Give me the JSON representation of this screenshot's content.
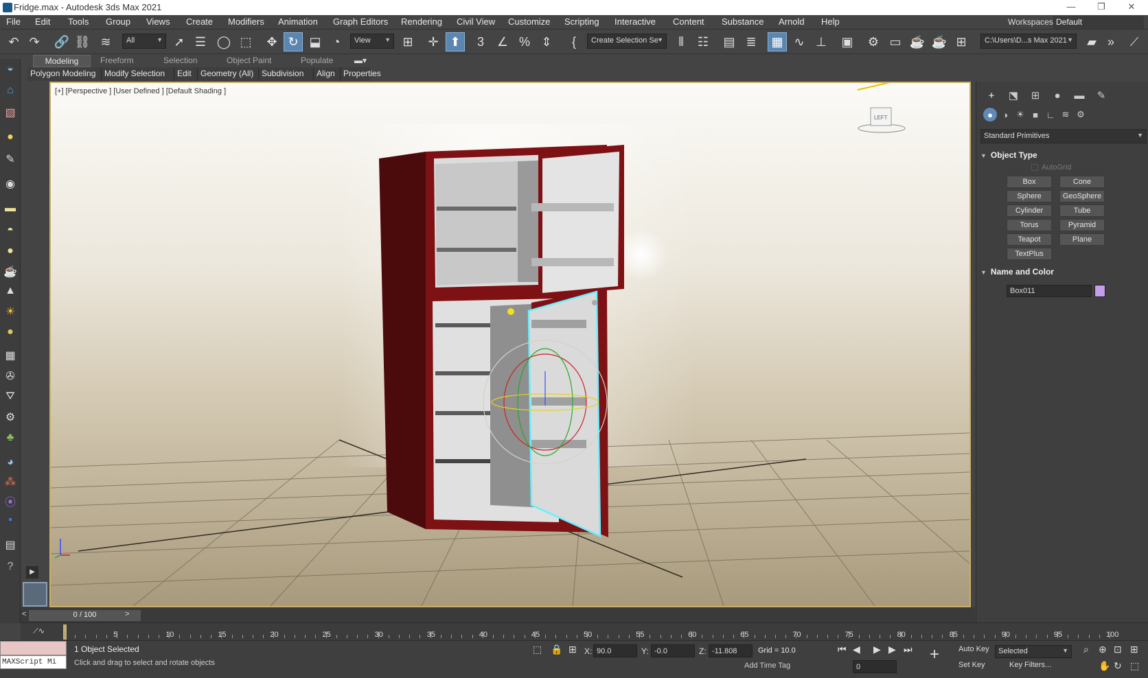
{
  "titlebar": {
    "title": "Fridge.max - Autodesk 3ds Max 2021",
    "minimize": "—",
    "restore": "❐",
    "close": "✕"
  },
  "menu": {
    "items": [
      "File",
      "Edit",
      "Tools",
      "Group",
      "Views",
      "Create",
      "Modifiers",
      "Animation",
      "Graph Editors",
      "Rendering",
      "Civil View",
      "Customize",
      "Scripting",
      "Interactive",
      "Content",
      "Substance",
      "Arnold",
      "Help"
    ],
    "workspaces_label": "Workspaces:",
    "workspace_value": "Default"
  },
  "toolbar": {
    "filter_value": "All",
    "refcoord_value": "View",
    "named_sel_value": "Create Selection Se",
    "path_value": "C:\\Users\\D...s Max 2021"
  },
  "ribbon": {
    "tabs": [
      "Modeling",
      "Freeform",
      "Selection",
      "Object Paint",
      "Populate"
    ],
    "items": [
      "Polygon Modeling",
      "Modify Selection",
      "Edit",
      "Geometry (All)",
      "Subdivision",
      "Align",
      "Properties"
    ]
  },
  "viewport": {
    "label": "[+] [Perspective ] [User Defined ] [Default Shading ]",
    "viewcube_face": "LEFT"
  },
  "command_panel": {
    "category": "Standard Primitives",
    "object_type_title": "Object Type",
    "autogrid_label": "AutoGrid",
    "primitives": [
      "Box",
      "Cone",
      "Sphere",
      "GeoSphere",
      "Cylinder",
      "Tube",
      "Torus",
      "Pyramid",
      "Teapot",
      "Plane",
      "TextPlus"
    ],
    "name_color_title": "Name and Color",
    "object_name": "Box011",
    "object_color": "#c49ee8"
  },
  "timeline": {
    "frame_display": "0 / 100",
    "prev": "<",
    "next": ">",
    "tick_labels": [
      "5",
      "10",
      "15",
      "20",
      "25",
      "30",
      "35",
      "40",
      "45",
      "50",
      "55",
      "60",
      "65",
      "70",
      "75",
      "80",
      "85",
      "90",
      "95",
      "100"
    ]
  },
  "status": {
    "maxscript_label": "MAXScript Mi",
    "selection_text": "1 Object Selected",
    "prompt_text": "Click and drag to select and rotate objects",
    "x_label": "X:",
    "x_value": "90.0",
    "y_label": "Y:",
    "y_value": "-0.0",
    "z_label": "Z:",
    "z_value": "-11.808",
    "grid_text": "Grid = 10.0",
    "add_time_tag": "Add Time Tag",
    "auto_key": "Auto Key",
    "set_key": "Set Key",
    "selected_value": "Selected",
    "key_filters": "Key Filters...",
    "frame_value": "0"
  },
  "colors": {
    "accent": "#5b86b0",
    "fridge_red": "#7e1114",
    "selection_cyan": "#66f0ff",
    "viewport_border": "#c9b06a"
  }
}
